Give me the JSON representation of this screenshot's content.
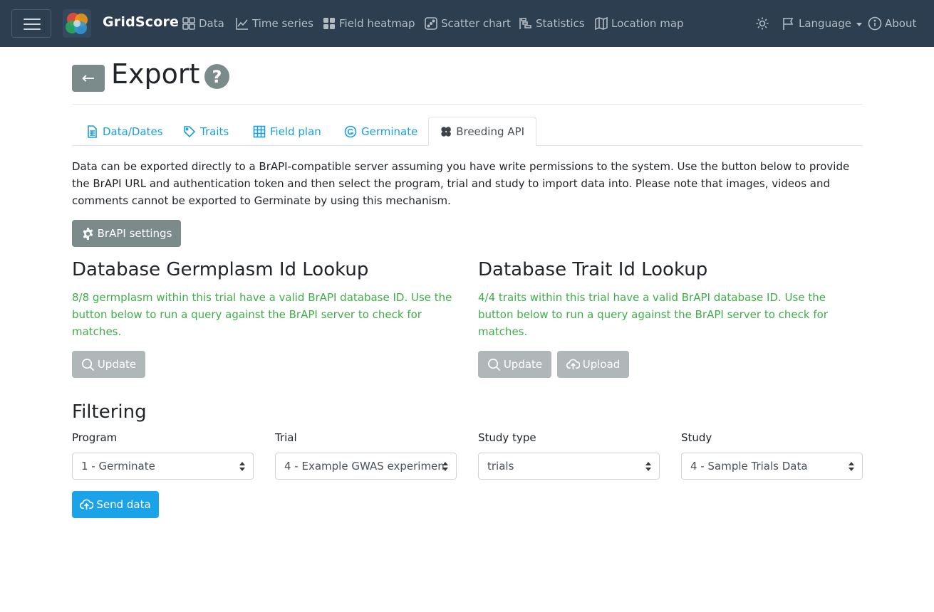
{
  "navbar": {
    "brand": "GridScore",
    "items": [
      {
        "label": "Data",
        "icon": "grid-check-icon"
      },
      {
        "label": "Time series",
        "icon": "line-chart-icon"
      },
      {
        "label": "Field heatmap",
        "icon": "grid-icon"
      },
      {
        "label": "Scatter chart",
        "icon": "dice-icon"
      },
      {
        "label": "Statistics",
        "icon": "bar-chart-steps-icon"
      },
      {
        "label": "Location map",
        "icon": "map-icon"
      }
    ],
    "theme_icon": "sun-icon",
    "language": "Language",
    "about": "About"
  },
  "header": {
    "back": "←",
    "title": "Export",
    "help": "?"
  },
  "tabs": [
    {
      "label": "Data/Dates",
      "icon": "file-spreadsheet-icon"
    },
    {
      "label": "Traits",
      "icon": "tags-icon"
    },
    {
      "label": "Field plan",
      "icon": "table-icon"
    },
    {
      "label": "Germinate",
      "icon": "germinate-icon"
    },
    {
      "label": "Breeding API",
      "icon": "brapi-icon",
      "active": true
    }
  ],
  "description": "Data can be exported directly to a BrAPI-compatible server assuming you have write permissions to the system. Use the button below to provide the BrAPI URL and authentication token and then select the program, trial and study to import data into. Please note that images, videos and comments cannot be exported to Germinate by using this mechanism.",
  "settings_button": "BrAPI settings",
  "germplasm": {
    "title": "Database Germplasm Id Lookup",
    "status": "8/8 germplasm within this trial have a valid BrAPI database ID. Use the button below to run a query against the BrAPI server to check for matches.",
    "update": "Update"
  },
  "traits": {
    "title": "Database Trait Id Lookup",
    "status": "4/4 traits within this trial have a valid BrAPI database ID. Use the button below to run a query against the BrAPI server to check for matches.",
    "update": "Update",
    "upload": "Upload"
  },
  "filtering": {
    "title": "Filtering",
    "fields": [
      {
        "label": "Program",
        "value": "1 - Germinate"
      },
      {
        "label": "Trial",
        "value": "4 - Example GWAS experimen"
      },
      {
        "label": "Study type",
        "value": "trials"
      },
      {
        "label": "Study",
        "value": "4 - Sample Trials Data"
      }
    ]
  },
  "send_button": "Send data",
  "colors": {
    "navbar": "#2c3e50",
    "link": "#1a9ee0",
    "success": "#3fae49",
    "secondary": "#7b8a8b",
    "primary": "#1aa3e8"
  }
}
